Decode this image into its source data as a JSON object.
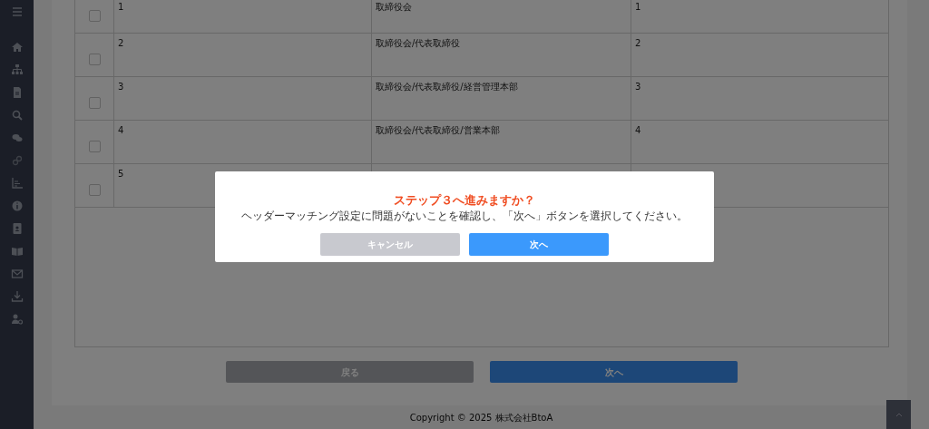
{
  "table": {
    "rows": [
      {
        "checked": false,
        "cells": [
          "1",
          "取締役会",
          "1"
        ]
      },
      {
        "checked": false,
        "cells": [
          "2",
          "取締役会/代表取締役",
          "2"
        ]
      },
      {
        "checked": false,
        "cells": [
          "3",
          "取締役会/代表取締役/経営管理本部",
          "3"
        ]
      },
      {
        "checked": false,
        "cells": [
          "4",
          "取締役会/代表取締役/営業本部",
          "4"
        ]
      },
      {
        "checked": false,
        "cells": [
          "5",
          "",
          ""
        ]
      }
    ]
  },
  "footer_buttons": [
    {
      "label": "戻る",
      "kind": "back"
    },
    {
      "label": "次へ",
      "kind": "next"
    }
  ],
  "copyright": "Copyright © 2025 株式会社BtoA",
  "modal": {
    "title": "ステップ３へ進みますか？",
    "message": "ヘッダーマッチング設定に問題がないことを確認し、「次へ」ボタンを選択してください。",
    "buttons": [
      {
        "label": "キャンセル",
        "kind": "cancel"
      },
      {
        "label": "次へ",
        "kind": "next"
      }
    ]
  }
}
